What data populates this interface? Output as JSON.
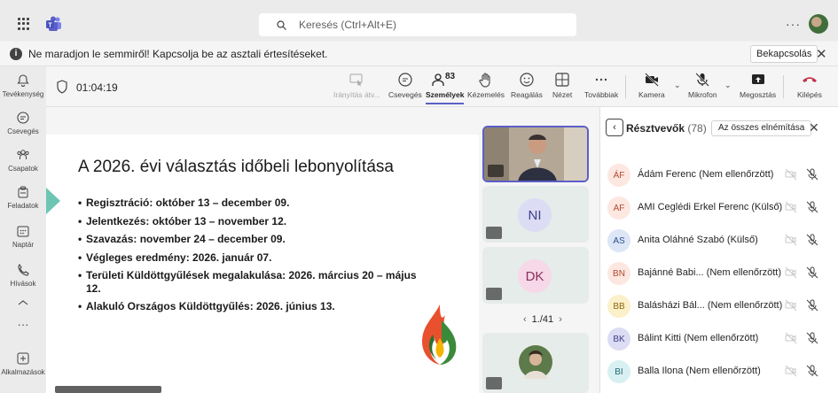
{
  "topbar": {
    "search_placeholder": "Keresés (Ctrl+Alt+E)",
    "more": "···"
  },
  "notification": {
    "message": "Ne maradjon le semmiről! Kapcsolja be az asztali értesítéseket.",
    "action": "Bekapcsolás",
    "close": "✕"
  },
  "rail": {
    "items": [
      {
        "label": "Tevékenység"
      },
      {
        "label": "Csevegés"
      },
      {
        "label": "Csapatok"
      },
      {
        "label": "Feladatok"
      },
      {
        "label": "Naptár"
      },
      {
        "label": "Hívások"
      },
      {
        "label": "Alkalmazások"
      }
    ],
    "more": "···"
  },
  "meeting": {
    "timer": "01:04:19",
    "tools": {
      "share_control": "Irányítás átv...",
      "chat": "Csevegés",
      "people": "Személyek",
      "people_count": "83",
      "raise_hand": "Kézemelés",
      "react": "Reagálás",
      "view": "Nézet",
      "more": "Továbbiak",
      "camera": "Kamera",
      "mic": "Mikrofon",
      "share": "Megosztás",
      "leave": "Kilépés"
    }
  },
  "slide": {
    "title": "A 2026. évi választás időbeli lebonyolítása",
    "bullets": [
      "Regisztráció: október 13 – december 09.",
      "Jelentkezés: október 13 – november 12.",
      "Szavazás: november 24 – december 09.",
      "Végleges eredmény: 2026. január 07.",
      "Területi Küldöttgyűlések megalakulása: 2026. március 20 – május 12.",
      "Alakuló Országos Küldöttgyűlés: 2026. június 13."
    ]
  },
  "tiles": [
    {
      "initials": "NI"
    },
    {
      "initials": "DK"
    }
  ],
  "pager": {
    "text": "1./41",
    "prev": "‹",
    "next": "›"
  },
  "panel": {
    "title": "Résztvevők",
    "count": "(78)",
    "mute_all": "Az összes elnémítása",
    "close": "✕",
    "back": "‹",
    "participants": [
      {
        "initials": "ÁF",
        "name": "Ádám Ferenc (Nem ellenőrzött)",
        "bg": "#fde7e1",
        "fg": "#b04a2f"
      },
      {
        "initials": "AF",
        "name": "AMI Ceglédi Erkel Ferenc (Külső)",
        "bg": "#fde7e1",
        "fg": "#b04a2f"
      },
      {
        "initials": "AS",
        "name": "Anita Oláhné Szabó (Külső)",
        "bg": "#dce6f7",
        "fg": "#2b4f8a"
      },
      {
        "initials": "BN",
        "name": "Bajánné Babi... (Nem ellenőrzött)",
        "bg": "#fde7e1",
        "fg": "#b04a2f"
      },
      {
        "initials": "BB",
        "name": "Balásházi Bál... (Nem ellenőrzött)",
        "bg": "#fbf0c9",
        "fg": "#8a6a10"
      },
      {
        "initials": "BK",
        "name": "Bálint Kitti (Nem ellenőrzött)",
        "bg": "#dcdcf4",
        "fg": "#3f3f8a"
      },
      {
        "initials": "BI",
        "name": "Balla Ilona (Nem ellenőrzött)",
        "bg": "#d8f0f2",
        "fg": "#206a72"
      }
    ]
  }
}
